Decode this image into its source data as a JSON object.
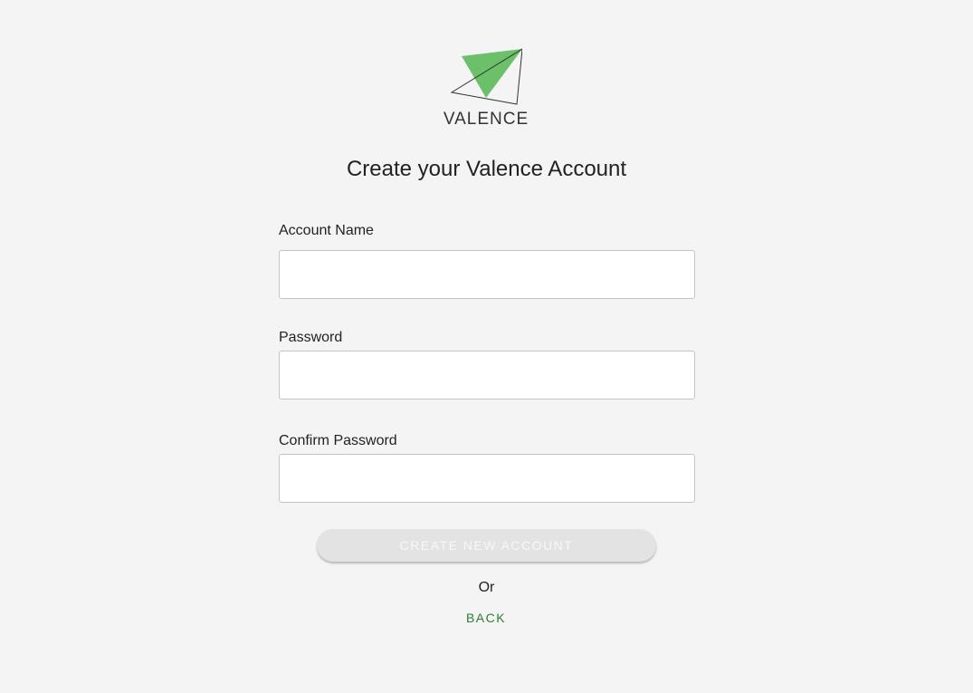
{
  "brand": {
    "name": "VALENCE",
    "logo_icon": "paper-plane-triangle-icon",
    "accent_color": "#6cc06a",
    "link_color": "#2e7d32"
  },
  "page": {
    "title": "Create your Valence Account"
  },
  "form": {
    "account_name": {
      "label": "Account Name",
      "value": "",
      "placeholder": ""
    },
    "password": {
      "label": "Password",
      "value": "",
      "placeholder": ""
    },
    "confirm_password": {
      "label": "Confirm Password",
      "value": "",
      "placeholder": ""
    },
    "create_button_label": "CREATE NEW ACCOUNT",
    "or_label": "Or",
    "back_label": "BACK"
  }
}
